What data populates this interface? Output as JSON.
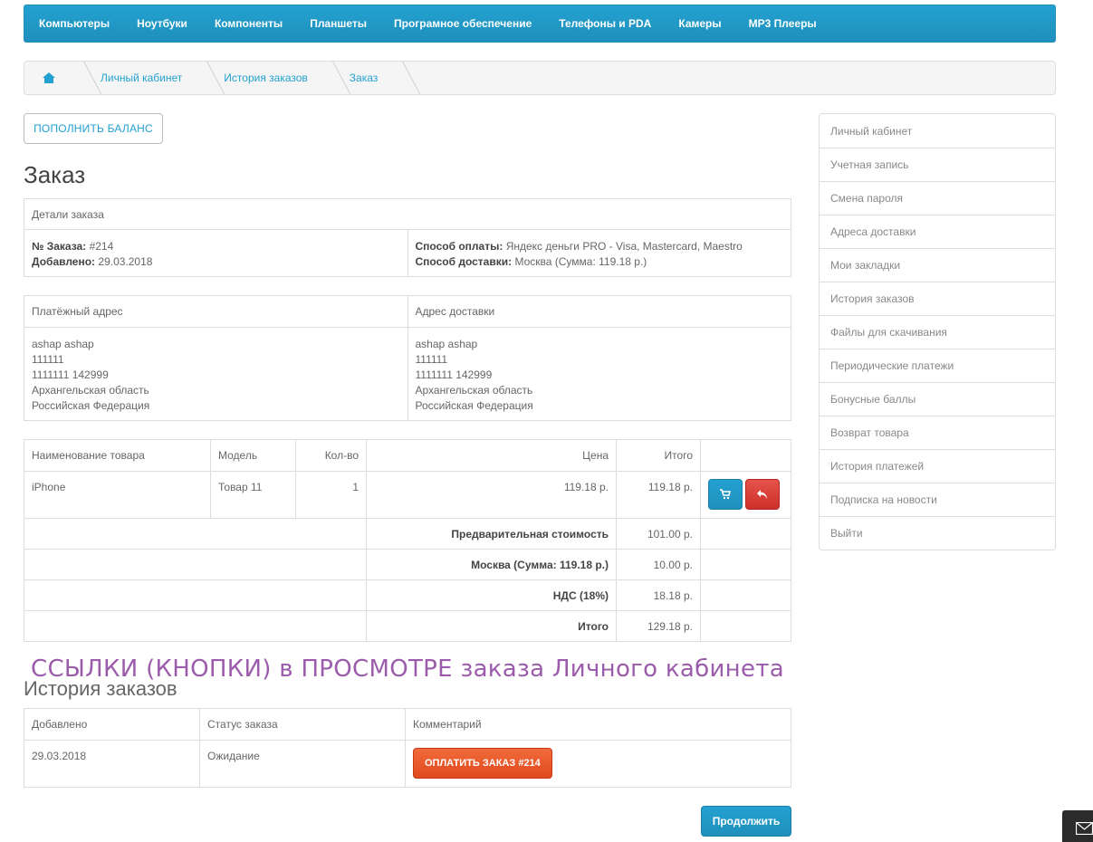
{
  "menu": [
    "Компьютеры",
    "Ноутбуки",
    "Компоненты",
    "Планшеты",
    "Програмное обеспечение",
    "Телефоны и PDA",
    "Камеры",
    "MP3 Плееры"
  ],
  "breadcrumb": {
    "home_icon": "home-icon",
    "items": [
      "Личный кабинет",
      "История заказов",
      "Заказ"
    ]
  },
  "balance_button": "ПОПОЛНИТЬ БАЛАНС",
  "page_title": "Заказ",
  "order_details": {
    "header": "Детали заказа",
    "order_no_label": "№ Заказа:",
    "order_no": "#214",
    "added_label": "Добавлено:",
    "added": "29.03.2018",
    "payment_label": "Способ оплаты:",
    "payment": "Яндекс деньги PRO - Visa, Mastercard, Maestro",
    "shipping_label": "Способ доставки:",
    "shipping": "Москва (Сумма: 119.18 р.)"
  },
  "addresses": {
    "payment_header": "Платёжный адрес",
    "shipping_header": "Адрес доставки",
    "payment_lines": [
      "ashap ashap",
      "111111",
      "1111111 142999",
      "Архангельская область",
      "Российская Федерация"
    ],
    "shipping_lines": [
      "ashap ashap",
      "111111",
      "1111111 142999",
      "Архангельская область",
      "Российская Федерация"
    ]
  },
  "products": {
    "headers": [
      "Наименование товара",
      "Модель",
      "Кол-во",
      "Цена",
      "Итого"
    ],
    "row": {
      "name": "iPhone",
      "model": "Товар 11",
      "qty": "1",
      "price": "119.18 р.",
      "total": "119.18 р."
    },
    "cart_icon": "cart-icon",
    "return_icon": "reply-icon",
    "totals": [
      {
        "label": "Предварительная стоимость",
        "value": "101.00 р."
      },
      {
        "label": "Москва (Сумма: 119.18 р.)",
        "value": "10.00 р."
      },
      {
        "label": "НДС (18%)",
        "value": "18.18 р."
      },
      {
        "label": "Итого",
        "value": "129.18 р."
      }
    ]
  },
  "overlay_text": "ССЫЛКИ (КНОПКИ) в ПРОСМОТРЕ заказа Личного кабинета",
  "history": {
    "title": "История заказов",
    "headers": [
      "Добавлено",
      "Статус заказа",
      "Комментарий"
    ],
    "row": {
      "date": "29.03.2018",
      "status": "Ожидание",
      "pay_button": "ОПЛАТИТЬ ЗАКАЗ #214"
    }
  },
  "continue_button": "Продолжить",
  "sidebar": [
    "Личный кабинет",
    "Учетная запись",
    "Смена пароля",
    "Адреса доставки",
    "Мои закладки",
    "История заказов",
    "Файлы для скачивания",
    "Периодические платежи",
    "Бонусные баллы",
    "Возврат товара",
    "История платежей",
    "Подписка на новости",
    "Выйти"
  ],
  "mail_icon": "mail-icon"
}
